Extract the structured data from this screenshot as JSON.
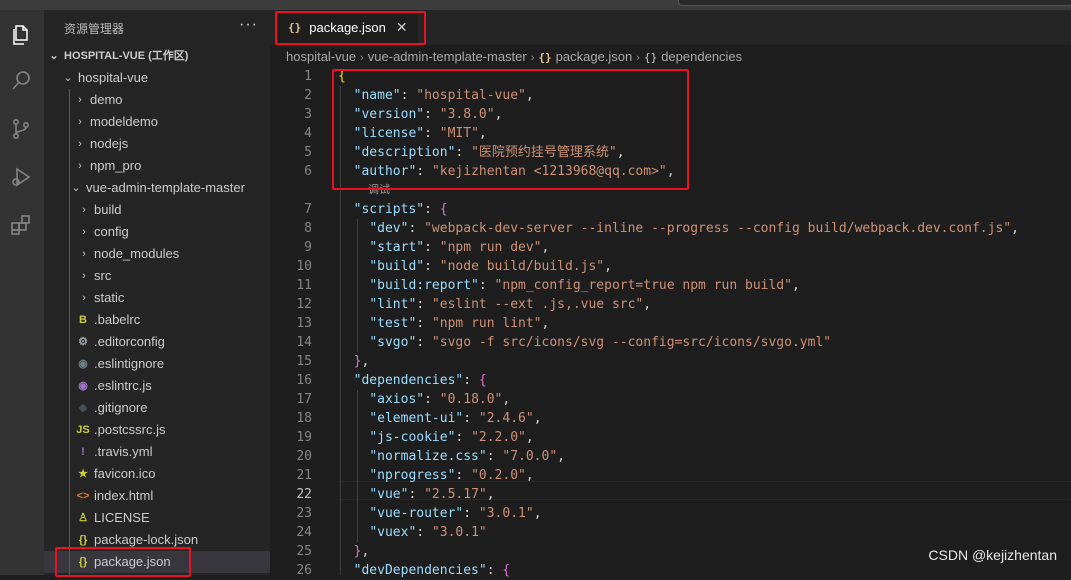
{
  "sidebar": {
    "title": "资源管理器",
    "more": "···",
    "workspace": "HOSPITAL-VUE (工作区)",
    "tree": [
      {
        "label": "hospital-vue",
        "type": "folder-open"
      },
      {
        "label": "demo",
        "type": "folder"
      },
      {
        "label": "modeldemo",
        "type": "folder"
      },
      {
        "label": "nodejs",
        "type": "folder"
      },
      {
        "label": "npm_pro",
        "type": "folder"
      },
      {
        "label": "vue-admin-template-master",
        "type": "folder-open"
      },
      {
        "label": "build",
        "type": "folder"
      },
      {
        "label": "config",
        "type": "folder"
      },
      {
        "label": "node_modules",
        "type": "folder"
      },
      {
        "label": "src",
        "type": "folder"
      },
      {
        "label": "static",
        "type": "folder"
      },
      {
        "label": ".babelrc",
        "icon": "B",
        "color": "#cbcb41"
      },
      {
        "label": ".editorconfig",
        "icon": "⚙",
        "color": "#9aa5ae"
      },
      {
        "label": ".eslintignore",
        "icon": "◉",
        "color": "#6d8086"
      },
      {
        "label": ".eslintrc.js",
        "icon": "◉",
        "color": "#a074c4"
      },
      {
        "label": ".gitignore",
        "icon": "◆",
        "color": "#41535b"
      },
      {
        "label": ".postcssrc.js",
        "icon": "JS",
        "color": "#cbcb41"
      },
      {
        "label": ".travis.yml",
        "icon": "!",
        "color": "#a074c4"
      },
      {
        "label": "favicon.ico",
        "icon": "★",
        "color": "#cbcb41"
      },
      {
        "label": "index.html",
        "icon": "<>",
        "color": "#e37933"
      },
      {
        "label": "LICENSE",
        "icon": "♙",
        "color": "#cbcb41"
      },
      {
        "label": "package-lock.json",
        "icon": "{}",
        "color": "#cbcb41"
      },
      {
        "label": "package.json",
        "icon": "{}",
        "color": "#cbcb41",
        "selected": true
      }
    ]
  },
  "tab": {
    "icon": "{}",
    "label": "package.json",
    "close": "✕"
  },
  "breadcrumb": {
    "parts": [
      "hospital-vue",
      "vue-admin-template-master",
      "package.json",
      "dependencies"
    ],
    "sep": "›",
    "json_icon": "{}",
    "obj_icon": "{}"
  },
  "codelens": "调试",
  "current_line": 22,
  "code": [
    {
      "n": "1",
      "t": [
        [
          "b1",
          "{"
        ]
      ]
    },
    {
      "n": "2",
      "t": [
        [
          "p",
          "  "
        ],
        [
          "k",
          "\"name\""
        ],
        [
          "p",
          ": "
        ],
        [
          "s",
          "\"hospital-vue\""
        ],
        [
          "p",
          ","
        ]
      ]
    },
    {
      "n": "3",
      "t": [
        [
          "p",
          "  "
        ],
        [
          "k",
          "\"version\""
        ],
        [
          "p",
          ": "
        ],
        [
          "s",
          "\"3.8.0\""
        ],
        [
          "p",
          ","
        ]
      ]
    },
    {
      "n": "4",
      "t": [
        [
          "p",
          "  "
        ],
        [
          "k",
          "\"license\""
        ],
        [
          "p",
          ": "
        ],
        [
          "s",
          "\"MIT\""
        ],
        [
          "p",
          ","
        ]
      ]
    },
    {
      "n": "5",
      "t": [
        [
          "p",
          "  "
        ],
        [
          "k",
          "\"description\""
        ],
        [
          "p",
          ": "
        ],
        [
          "s",
          "\"医院预约挂号管理系统\""
        ],
        [
          "p",
          ","
        ]
      ]
    },
    {
      "n": "6",
      "t": [
        [
          "p",
          "  "
        ],
        [
          "k",
          "\"author\""
        ],
        [
          "p",
          ": "
        ],
        [
          "s",
          "\"kejizhentan <1213968@qq.com>\""
        ],
        [
          "p",
          ","
        ]
      ]
    },
    {
      "n": "7",
      "t": [
        [
          "p",
          "  "
        ],
        [
          "k",
          "\"scripts\""
        ],
        [
          "p",
          ": "
        ],
        [
          "b2",
          "{"
        ]
      ]
    },
    {
      "n": "8",
      "t": [
        [
          "p",
          "    "
        ],
        [
          "k",
          "\"dev\""
        ],
        [
          "p",
          ": "
        ],
        [
          "s",
          "\"webpack-dev-server --inline --progress --config build/webpack.dev.conf.js\""
        ],
        [
          "p",
          ","
        ]
      ]
    },
    {
      "n": "9",
      "t": [
        [
          "p",
          "    "
        ],
        [
          "k",
          "\"start\""
        ],
        [
          "p",
          ": "
        ],
        [
          "s",
          "\"npm run dev\""
        ],
        [
          "p",
          ","
        ]
      ]
    },
    {
      "n": "10",
      "t": [
        [
          "p",
          "    "
        ],
        [
          "k",
          "\"build\""
        ],
        [
          "p",
          ": "
        ],
        [
          "s",
          "\"node build/build.js\""
        ],
        [
          "p",
          ","
        ]
      ]
    },
    {
      "n": "11",
      "t": [
        [
          "p",
          "    "
        ],
        [
          "k",
          "\"build:report\""
        ],
        [
          "p",
          ": "
        ],
        [
          "s",
          "\"npm_config_report=true npm run build\""
        ],
        [
          "p",
          ","
        ]
      ]
    },
    {
      "n": "12",
      "t": [
        [
          "p",
          "    "
        ],
        [
          "k",
          "\"lint\""
        ],
        [
          "p",
          ": "
        ],
        [
          "s",
          "\"eslint --ext .js,.vue src\""
        ],
        [
          "p",
          ","
        ]
      ]
    },
    {
      "n": "13",
      "t": [
        [
          "p",
          "    "
        ],
        [
          "k",
          "\"test\""
        ],
        [
          "p",
          ": "
        ],
        [
          "s",
          "\"npm run lint\""
        ],
        [
          "p",
          ","
        ]
      ]
    },
    {
      "n": "14",
      "t": [
        [
          "p",
          "    "
        ],
        [
          "k",
          "\"svgo\""
        ],
        [
          "p",
          ": "
        ],
        [
          "s",
          "\"svgo -f src/icons/svg --config=src/icons/svgo.yml\""
        ]
      ]
    },
    {
      "n": "15",
      "t": [
        [
          "p",
          "  "
        ],
        [
          "b2",
          "}"
        ],
        [
          "p",
          ","
        ]
      ]
    },
    {
      "n": "16",
      "t": [
        [
          "p",
          "  "
        ],
        [
          "k",
          "\"dependencies\""
        ],
        [
          "p",
          ": "
        ],
        [
          "b2",
          "{"
        ]
      ]
    },
    {
      "n": "17",
      "t": [
        [
          "p",
          "    "
        ],
        [
          "k",
          "\"axios\""
        ],
        [
          "p",
          ": "
        ],
        [
          "s",
          "\"0.18.0\""
        ],
        [
          "p",
          ","
        ]
      ]
    },
    {
      "n": "18",
      "t": [
        [
          "p",
          "    "
        ],
        [
          "k",
          "\"element-ui\""
        ],
        [
          "p",
          ": "
        ],
        [
          "s",
          "\"2.4.6\""
        ],
        [
          "p",
          ","
        ]
      ]
    },
    {
      "n": "19",
      "t": [
        [
          "p",
          "    "
        ],
        [
          "k",
          "\"js-cookie\""
        ],
        [
          "p",
          ": "
        ],
        [
          "s",
          "\"2.2.0\""
        ],
        [
          "p",
          ","
        ]
      ]
    },
    {
      "n": "20",
      "t": [
        [
          "p",
          "    "
        ],
        [
          "k",
          "\"normalize.css\""
        ],
        [
          "p",
          ": "
        ],
        [
          "s",
          "\"7.0.0\""
        ],
        [
          "p",
          ","
        ]
      ]
    },
    {
      "n": "21",
      "t": [
        [
          "p",
          "    "
        ],
        [
          "k",
          "\"nprogress\""
        ],
        [
          "p",
          ": "
        ],
        [
          "s",
          "\"0.2.0\""
        ],
        [
          "p",
          ","
        ]
      ]
    },
    {
      "n": "22",
      "t": [
        [
          "p",
          "    "
        ],
        [
          "k",
          "\"vue\""
        ],
        [
          "p",
          ": "
        ],
        [
          "s",
          "\"2.5.17\""
        ],
        [
          "p",
          ","
        ]
      ]
    },
    {
      "n": "23",
      "t": [
        [
          "p",
          "    "
        ],
        [
          "k",
          "\"vue-router\""
        ],
        [
          "p",
          ": "
        ],
        [
          "s",
          "\"3.0.1\""
        ],
        [
          "p",
          ","
        ]
      ]
    },
    {
      "n": "24",
      "t": [
        [
          "p",
          "    "
        ],
        [
          "k",
          "\"vuex\""
        ],
        [
          "p",
          ": "
        ],
        [
          "s",
          "\"3.0.1\""
        ]
      ]
    },
    {
      "n": "25",
      "t": [
        [
          "p",
          "  "
        ],
        [
          "b2",
          "}"
        ],
        [
          "p",
          ","
        ]
      ]
    },
    {
      "n": "26",
      "t": [
        [
          "p",
          "  "
        ],
        [
          "k",
          "\"devDependencies\""
        ],
        [
          "p",
          ": "
        ],
        [
          "b2",
          "{"
        ]
      ]
    }
  ],
  "watermark": "CSDN @kejizhentan",
  "colors": {
    "highlight_box": "#e81224",
    "accent": "#007acc"
  }
}
